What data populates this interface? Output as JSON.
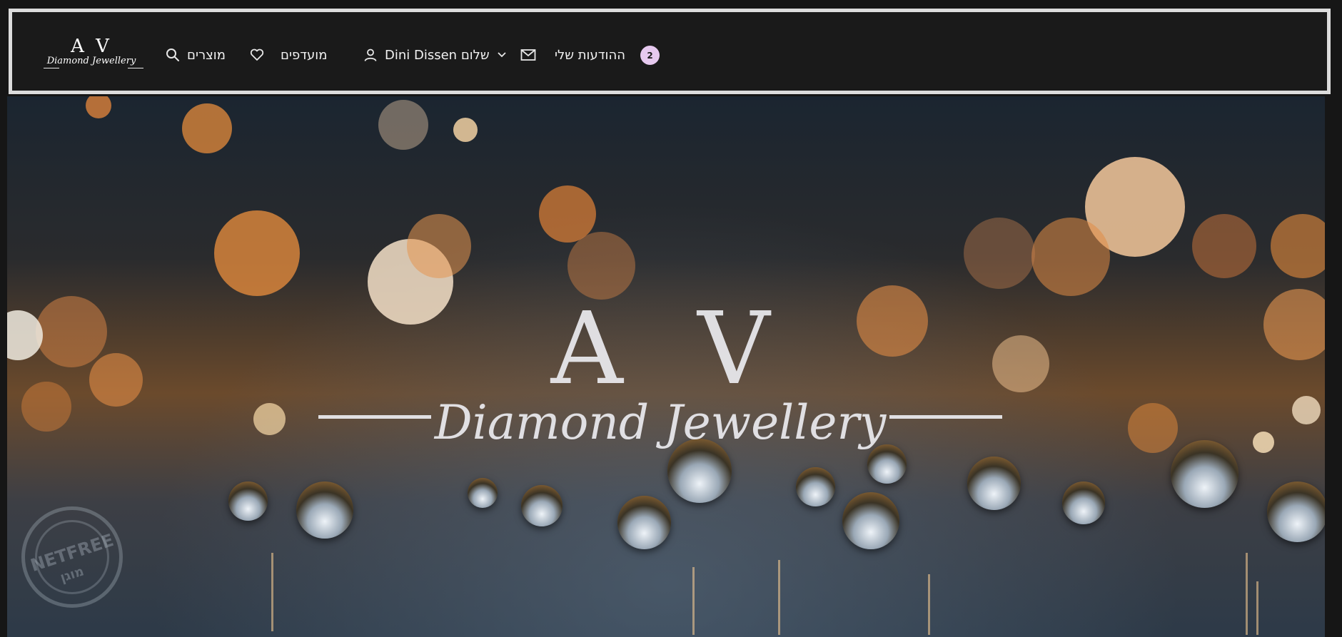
{
  "header": {
    "logo": {
      "initials": "A V",
      "script": "Diamond Jewellery"
    },
    "nav": {
      "products_label": "מוצרים",
      "favorites_label": "מועדפים",
      "user_label": "Dini Dissen שלום",
      "messages_label": "ההודעות שלי",
      "messages_count": "2"
    },
    "icons": {
      "products": "search-icon",
      "favorites": "heart-icon",
      "user": "user-icon",
      "user_dropdown": "chevron-down-icon",
      "messages": "mail-icon"
    },
    "colors": {
      "badge": "#e6c9ef",
      "bar": "#1a1a1a",
      "border": "#dcdcdc"
    }
  },
  "hero": {
    "logo_initials": "A V",
    "logo_script": "Diamond Jewellery",
    "stamp_text": "NETFREE",
    "stamp_subtext": "מוגן"
  }
}
